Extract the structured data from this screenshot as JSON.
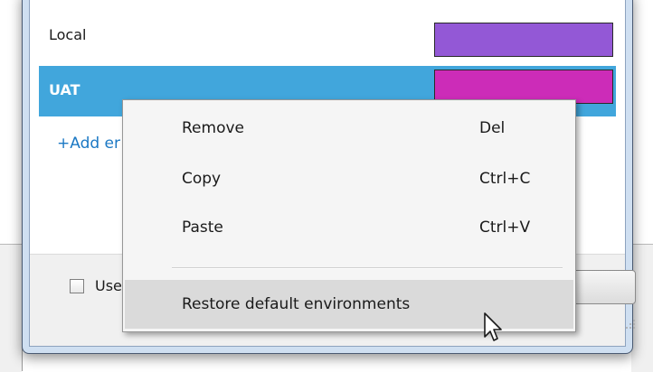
{
  "environments": [
    {
      "name": "Local",
      "color": "#9358d6"
    },
    {
      "name": "UAT",
      "color": "#cc2cb8"
    }
  ],
  "selected_environment": "UAT",
  "add_environment_label": "+Add er",
  "footer": {
    "checkbox_label": "Use",
    "checkbox_checked": false
  },
  "context_menu": {
    "items": [
      {
        "label": "Remove",
        "shortcut": "Del"
      },
      {
        "label": "Copy",
        "shortcut": "Ctrl+C"
      },
      {
        "label": "Paste",
        "shortcut": "Ctrl+V"
      }
    ],
    "restore_label": "Restore default environments"
  },
  "colors": {
    "selection": "#41a6dc",
    "link": "#1b78c4",
    "menu_background": "#f5f5f5",
    "menu_hover": "#dadada"
  },
  "icons": {
    "cursor": "mouse-pointer-icon",
    "resize_grip": "resize-grip-icon"
  }
}
